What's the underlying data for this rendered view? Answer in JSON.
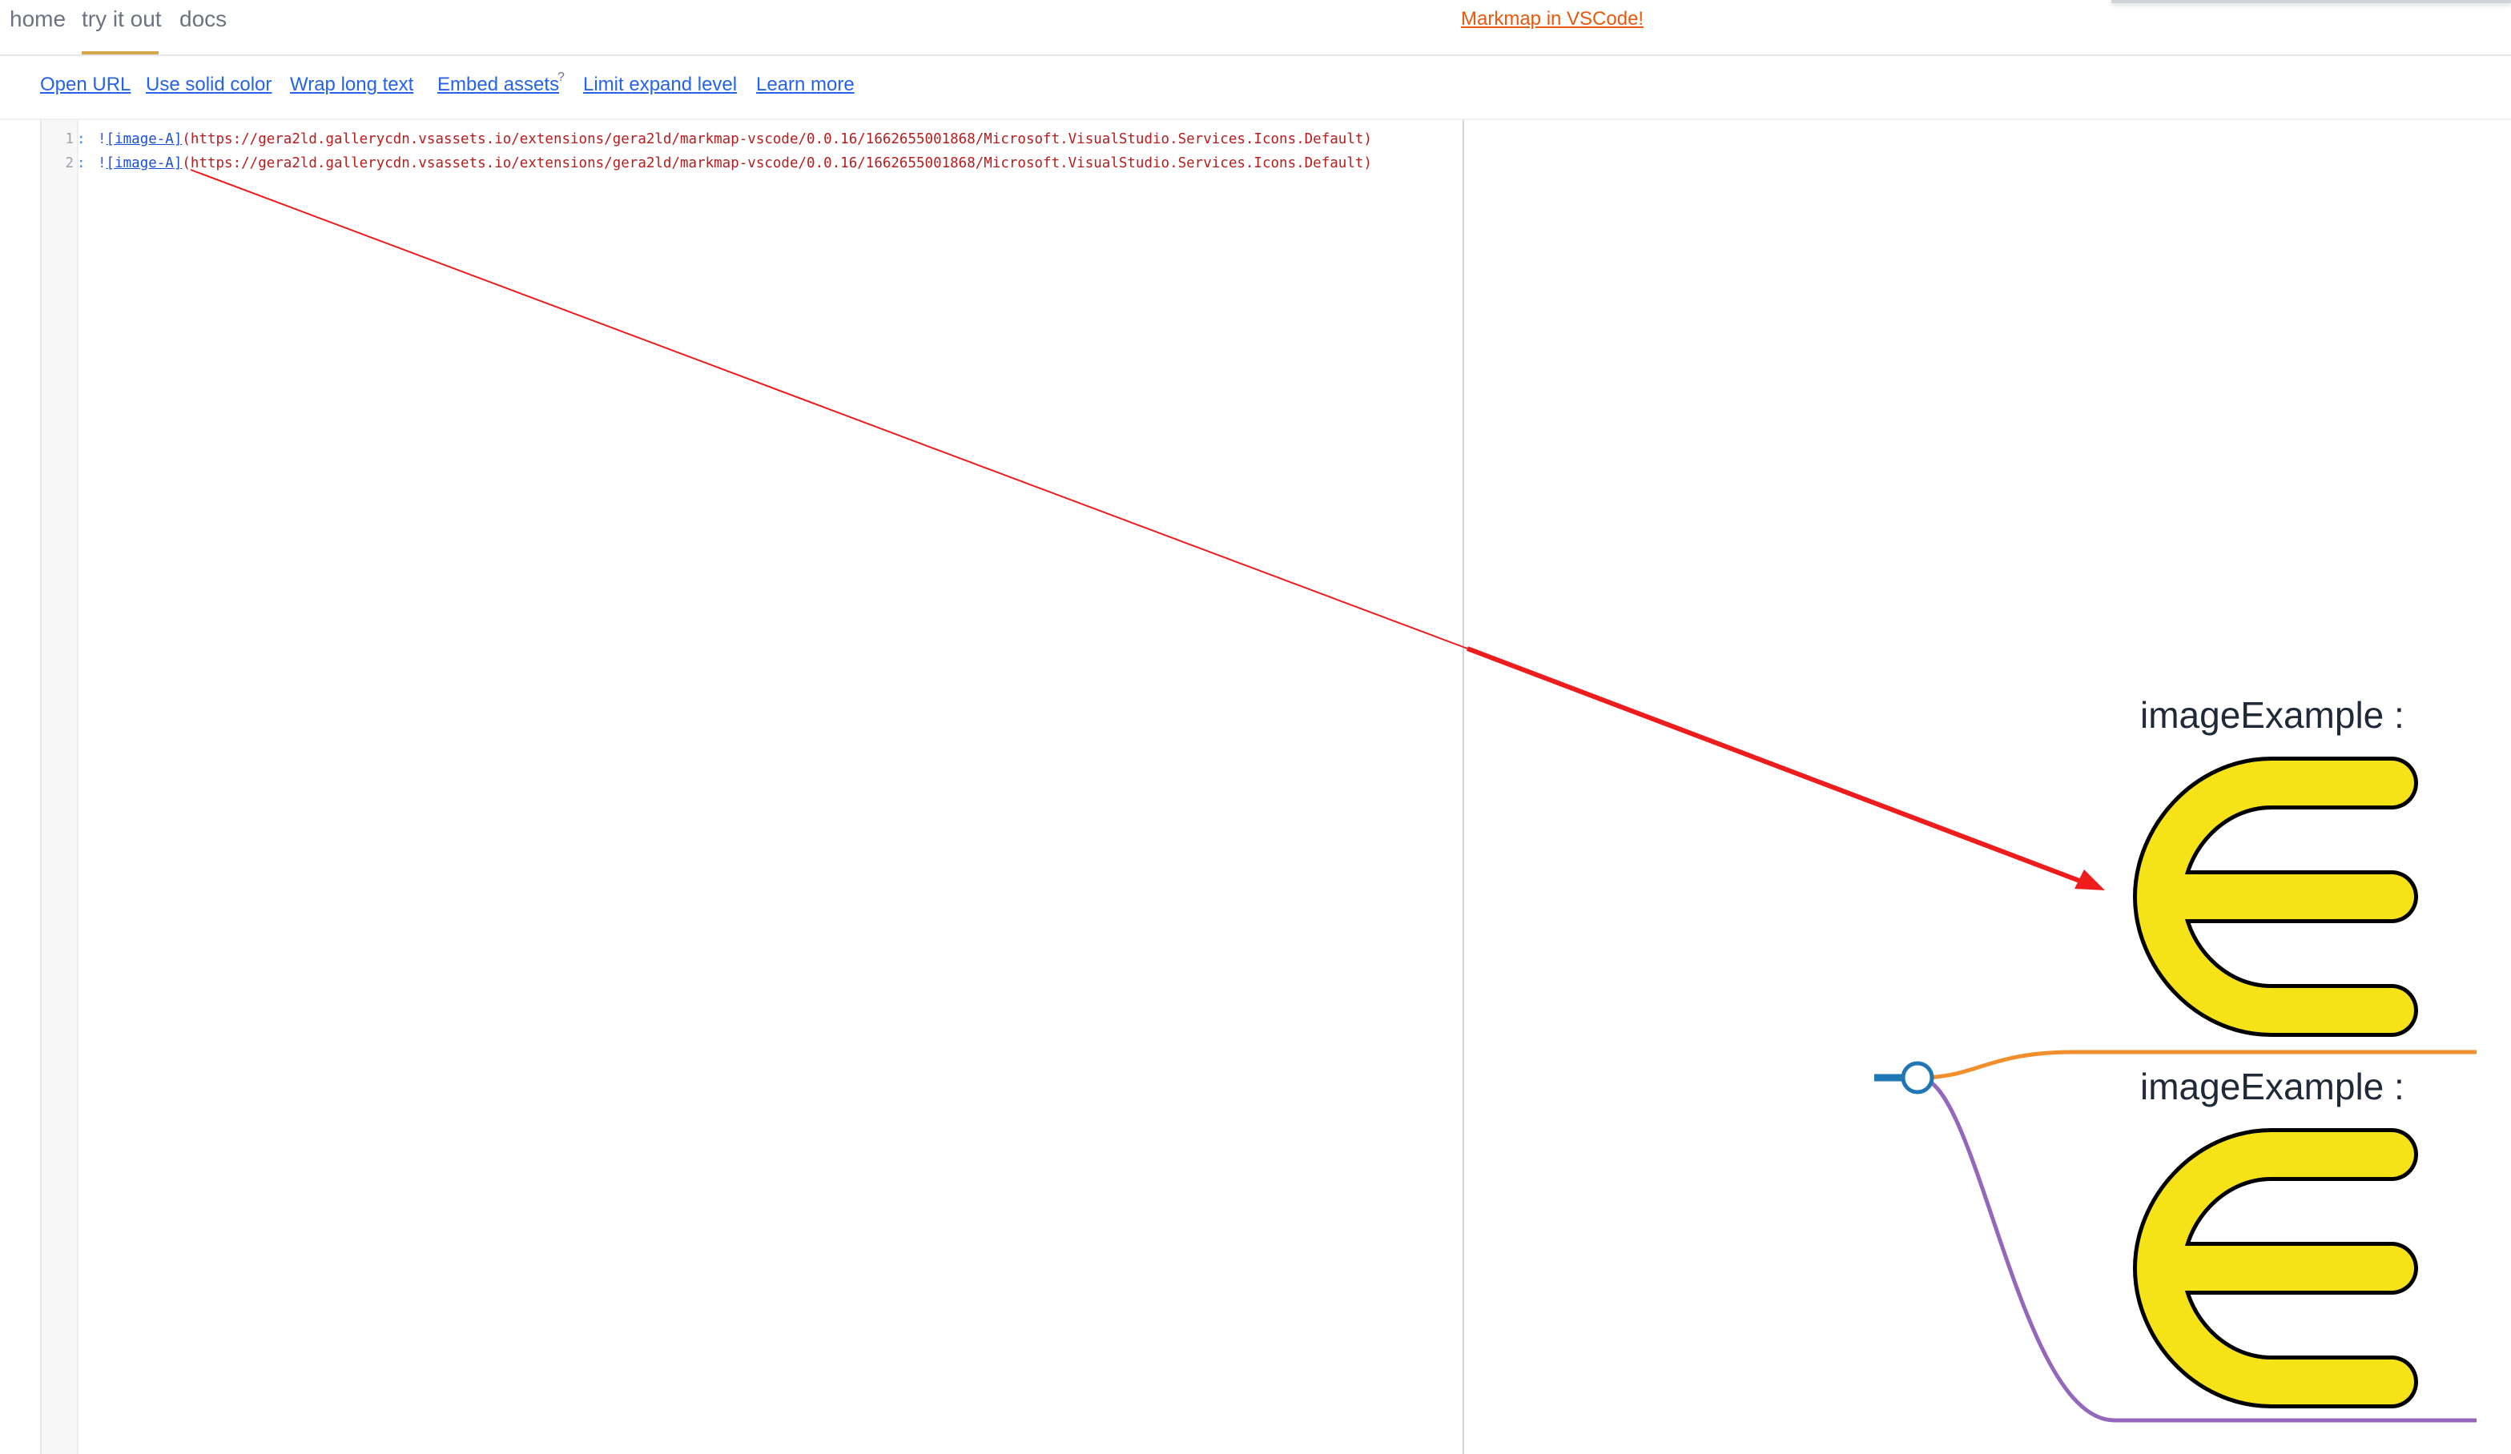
{
  "nav": {
    "home": "home",
    "try": "try it out",
    "docs": "docs",
    "promo": "Markmap in VSCode!"
  },
  "toolbar": {
    "open_url": "Open URL",
    "solid_color": "Use solid color",
    "wrap_text": "Wrap long text",
    "embed_assets": "Embed assets",
    "embed_help": "?",
    "limit_expand": "Limit expand level",
    "learn_more": "Learn more"
  },
  "editor": {
    "lines": [
      {
        "number": "1",
        "sep": ":",
        "bang": "!",
        "alt": "[image-A]",
        "url": "(https://gera2ld.gallerycdn.vsassets.io/extensions/gera2ld/markmap-vscode/0.0.16/1662655001868/Microsoft.VisualStudio.Services.Icons.Default)"
      },
      {
        "number": "2",
        "sep": ":",
        "bang": "!",
        "alt": "[image-A]",
        "url": "(https://gera2ld.gallerycdn.vsassets.io/extensions/gera2ld/markmap-vscode/0.0.16/1662655001868/Microsoft.VisualStudio.Services.Icons.Default)"
      }
    ]
  },
  "mindmap": {
    "nodes": [
      {
        "label": "imageExample",
        "suffix": ":",
        "icon": "markmap-logo-icon",
        "branch_color": "#f28e2b"
      },
      {
        "label": "imageExample",
        "suffix": ":",
        "icon": "markmap-logo-icon",
        "branch_color": "#9467bd"
      }
    ],
    "root_color": "#1f77b4",
    "logo_fill": "#f5e318",
    "annotation_color": "#ee1c1c"
  }
}
